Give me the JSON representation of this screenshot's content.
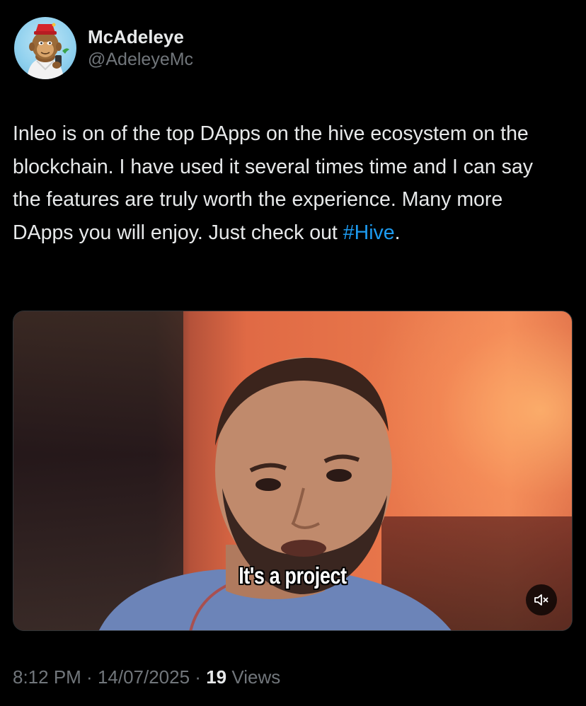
{
  "author": {
    "display_name": "McAdeleye",
    "handle": "@AdeleyeMc"
  },
  "tweet": {
    "text_before_hashtag": "Inleo is on of the top DApps on the hive ecosystem on the blockchain. I have used it several times time and I can say the features are truly worth the experience. Many more DApps you will enjoy. Just check out ",
    "hashtag": "#Hive",
    "text_after_hashtag": "."
  },
  "media": {
    "type": "video",
    "subtitle": "It's a project",
    "mute_icon": "speaker-muted-icon"
  },
  "meta": {
    "time": "8:12 PM",
    "separator": " · ",
    "date": "14/07/2025",
    "views_count": "19",
    "views_label": " Views"
  },
  "colors": {
    "background": "#000000",
    "text": "#e7e9ea",
    "secondary": "#71767b",
    "link": "#1d9bf0"
  }
}
